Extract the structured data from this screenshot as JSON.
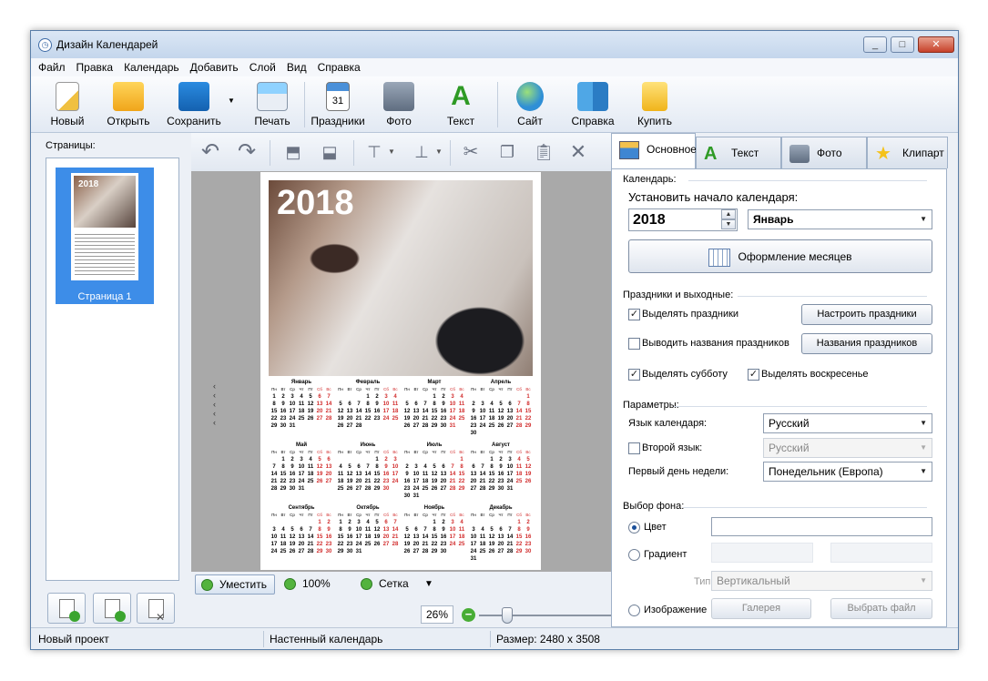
{
  "window": {
    "title": "Дизайн Календарей",
    "controls": [
      "_",
      "□",
      "✕"
    ]
  },
  "menu": [
    "Файл",
    "Правка",
    "Календарь",
    "Добавить",
    "Слой",
    "Вид",
    "Справка"
  ],
  "toolbar": {
    "new": "Новый",
    "open": "Открыть",
    "save": "Сохранить",
    "print": "Печать",
    "holidays": "Праздники",
    "photo": "Фото",
    "text": "Текст",
    "site": "Сайт",
    "help": "Справка",
    "buy": "Купить"
  },
  "pages": {
    "label": "Страницы:",
    "items": [
      {
        "caption": "Страница 1",
        "year": "2018"
      }
    ]
  },
  "editor_toolbar": {
    "icons": [
      "undo-icon",
      "redo-icon",
      "bring-forward-icon",
      "send-backward-icon",
      "align-top-icon",
      "align-bottom-icon",
      "cut-icon",
      "copy-icon",
      "paste-icon",
      "delete-icon"
    ]
  },
  "calendar": {
    "year": "2018",
    "day_headers": [
      "Пн",
      "Вт",
      "Ср",
      "Чт",
      "Пт",
      "Сб",
      "Вс"
    ],
    "months": [
      {
        "name": "Январь",
        "offset": 0,
        "days": 31
      },
      {
        "name": "Февраль",
        "offset": 3,
        "days": 28
      },
      {
        "name": "Март",
        "offset": 3,
        "days": 31
      },
      {
        "name": "Апрель",
        "offset": 6,
        "days": 30
      },
      {
        "name": "Май",
        "offset": 1,
        "days": 31
      },
      {
        "name": "Июнь",
        "offset": 4,
        "days": 30
      },
      {
        "name": "Июль",
        "offset": 6,
        "days": 31
      },
      {
        "name": "Август",
        "offset": 2,
        "days": 31
      },
      {
        "name": "Сентябрь",
        "offset": 5,
        "days": 30
      },
      {
        "name": "Октябрь",
        "offset": 0,
        "days": 31
      },
      {
        "name": "Ноябрь",
        "offset": 3,
        "days": 30
      },
      {
        "name": "Декабрь",
        "offset": 5,
        "days": 31
      }
    ]
  },
  "canvas_bottom": {
    "fit": "Уместить",
    "hundred": "100%",
    "grid": "Сетка",
    "zoom": "26%"
  },
  "tabs": [
    "Основное",
    "Текст",
    "Фото",
    "Клипарт"
  ],
  "main_tab": {
    "calendar_group": "Календарь:",
    "set_start": "Установить начало календаря:",
    "year_value": "2018",
    "month_value": "Январь",
    "month_design_btn": "Оформление месяцев",
    "holidays_group": "Праздники и выходные:",
    "highlight_holidays": "Выделять праздники",
    "configure_holidays_btn": "Настроить праздники",
    "show_holiday_names": "Выводить названия праздников",
    "holiday_names_btn": "Названия праздников",
    "highlight_saturday": "Выделять субботу",
    "highlight_sunday": "Выделять воскресенье",
    "params_group": "Параметры:",
    "lang_label": "Язык календаря:",
    "lang_value": "Русский",
    "second_lang_label": "Второй язык:",
    "second_lang_value": "Русский",
    "first_day_label": "Первый день недели:",
    "first_day_value": "Понедельник (Европа)",
    "bg_group": "Выбор фона:",
    "bg_color": "Цвет",
    "bg_gradient": "Градиент",
    "bg_type_label": "Тип:",
    "bg_type_value": "Вертикальный",
    "bg_image": "Изображение",
    "gallery_btn": "Галерея",
    "choose_file_btn": "Выбрать файл"
  },
  "status": {
    "project": "Новый проект",
    "type": "Настенный календарь",
    "size": "Размер: 2480 x 3508"
  },
  "colors": {
    "accent": "#3d8de8",
    "weekend": "#d12a2a",
    "zoom_green": "#48ad35"
  }
}
